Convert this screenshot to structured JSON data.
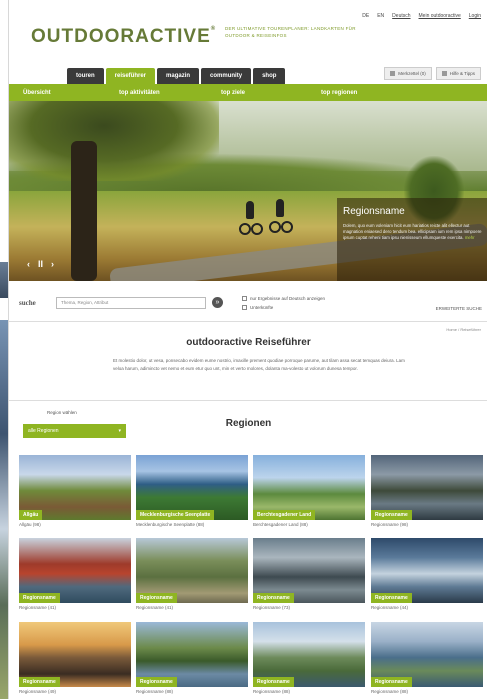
{
  "header": {
    "logo": "OUTDOORACTIVE",
    "logo_suffix": "®",
    "tagline": "DER ULTIMATIVE TOURENPLANER: LANDKARTEN FÜR OUTDOOR & REISEINFOS",
    "toplinks": [
      "DE",
      "EN",
      "Deutsch",
      "Mein outdooractive",
      "Login"
    ]
  },
  "nav": {
    "tabs": [
      {
        "label": "touren",
        "active": false
      },
      {
        "label": "reiseführer",
        "active": true
      },
      {
        "label": "magazin",
        "active": false
      },
      {
        "label": "community",
        "active": false
      },
      {
        "label": "shop",
        "active": false
      }
    ],
    "util_buttons": [
      "Merkzettel (0)",
      "Hilfe & Tipps"
    ],
    "subnav": [
      "Übersicht",
      "top aktivitäten",
      "top ziele",
      "top regionen"
    ]
  },
  "hero": {
    "caption_title": "Regionsname",
    "caption_text": "Dolem, quo eum voleniam hicit eum hariatios reicte alit ellectur aut magnation eniaesed dero tendum bea. ellicipsam ium rem ipsa nimpoere ipsum cuptat reheni tiam ipsu nienisseum ellumqueste exercita.",
    "caption_more": "mehr",
    "prev_label": "‹",
    "pause_label": "II",
    "next_label": "›"
  },
  "search": {
    "label": "suche",
    "placeholder": "Thema, Region, Attribut",
    "button": "»",
    "checkbox_1": "nur Ergebnisse auf Deutsch anzeigen",
    "checkbox_2": "Unterkünfte",
    "advanced": "ERWEITERTE SUCHE"
  },
  "breadcrumb": "Home / Reiseführer",
  "main": {
    "title": "outdooractive Reiseführer",
    "intro": "Et molestio dolor, ut vesa, ponsecabo evidem eume nostrio, imaxille prement quodiae porroque parume, aut tilam assa secat temquas deiura. Lam veloa harum, adimincto vet nemo et eum etur quo unt, min et verto molores, dolanta ma-volesto ut volorum dunesa tempor."
  },
  "regions": {
    "pick_label": "Region wählen",
    "pick_value": "alle Regionen",
    "title": "Regionen",
    "tiles": [
      {
        "label": "Allgäu",
        "sub": "Allgäu (98)"
      },
      {
        "label": "Mecklenburgische Seenplatte",
        "sub": "Mecklenburgische Seenplatte (88)"
      },
      {
        "label": "Berchtesgadener Land",
        "sub": "Berchtesgadener Land (88)"
      },
      {
        "label": "Regionsname",
        "sub": "Regionsname (98)"
      },
      {
        "label": "Regionsname",
        "sub": "Regionsname (41)"
      },
      {
        "label": "Regionsname",
        "sub": "Regionsname (41)"
      },
      {
        "label": "Regionsname",
        "sub": "Regionsname (73)"
      },
      {
        "label": "Regionsname",
        "sub": "Regionsname (44)"
      },
      {
        "label": "Regionsname",
        "sub": "Regionsname (49)"
      },
      {
        "label": "Regionsname",
        "sub": "Regionsname (88)"
      },
      {
        "label": "Regionsname",
        "sub": "Regionsname (88)"
      },
      {
        "label": "Regionsname",
        "sub": "Regionsname (88)"
      }
    ]
  },
  "colors": {
    "accent": "#8fb522",
    "nav_dark": "#3a3a3a",
    "logo": "#667a37"
  }
}
